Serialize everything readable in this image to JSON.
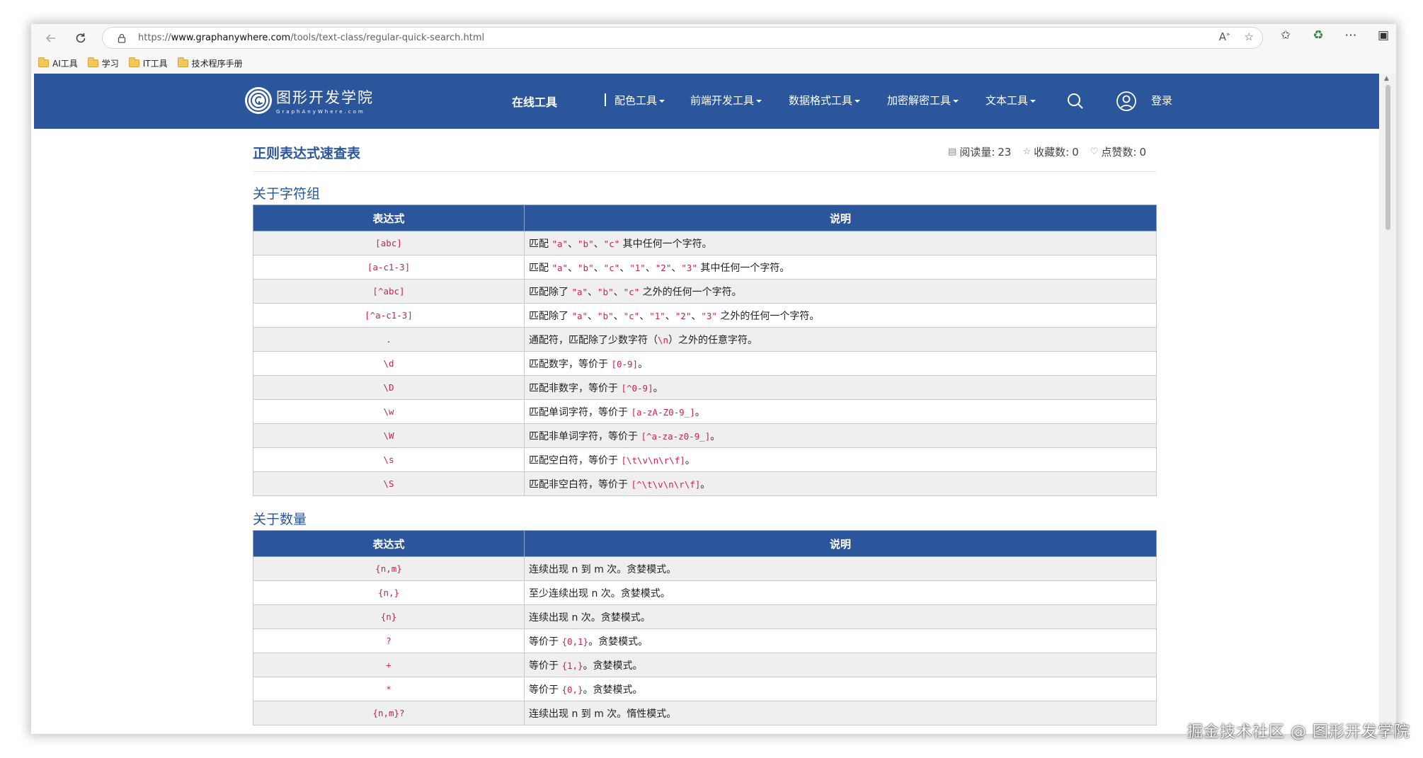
{
  "browser": {
    "url_prefix": "https://",
    "url_domain": "www.graphanywhere.com",
    "url_path": "/tools/text-class/regular-quick-search.html",
    "bookmarks": [
      {
        "label": "AI工具"
      },
      {
        "label": "学习"
      },
      {
        "label": "IT工具"
      },
      {
        "label": "技术程序手册"
      }
    ]
  },
  "site": {
    "logo_cn": "图形开发学院",
    "logo_en": "GraphAnyWhere.com",
    "nav_main": "在线工具",
    "nav": [
      {
        "label": "配色工具"
      },
      {
        "label": "前端开发工具"
      },
      {
        "label": "数据格式工具"
      },
      {
        "label": "加密解密工具"
      },
      {
        "label": "文本工具"
      }
    ],
    "login": "登录",
    "brand_color": "#2c569c"
  },
  "page": {
    "title": "正则表达式速查表",
    "reads_label": "阅读量:",
    "reads": "23",
    "favs_label": "收藏数:",
    "favs": "0",
    "likes_label": "点赞数:",
    "likes": "0"
  },
  "section1": {
    "title": "关于字符组",
    "col_expr": "表达式",
    "col_desc": "说明",
    "rows": [
      {
        "expr": "[abc]",
        "desc": [
          {
            "t": "匹配 "
          },
          {
            "c": "\"a\""
          },
          {
            "t": "、"
          },
          {
            "c": "\"b\""
          },
          {
            "t": "、"
          },
          {
            "c": "\"c\""
          },
          {
            "t": " 其中任何一个字符。"
          }
        ]
      },
      {
        "expr": "[a-c1-3]",
        "desc": [
          {
            "t": "匹配 "
          },
          {
            "c": "\"a\""
          },
          {
            "t": "、"
          },
          {
            "c": "\"b\""
          },
          {
            "t": "、"
          },
          {
            "c": "\"c\""
          },
          {
            "t": "、"
          },
          {
            "c": "\"1\""
          },
          {
            "t": "、"
          },
          {
            "c": "\"2\""
          },
          {
            "t": "、"
          },
          {
            "c": "\"3\""
          },
          {
            "t": " 其中任何一个字符。"
          }
        ]
      },
      {
        "expr": "[^abc]",
        "desc": [
          {
            "t": "匹配除了 "
          },
          {
            "c": "\"a\""
          },
          {
            "t": "、"
          },
          {
            "c": "\"b\""
          },
          {
            "t": "、"
          },
          {
            "c": "\"c\""
          },
          {
            "t": " 之外的任何一个字符。"
          }
        ]
      },
      {
        "expr": "[^a-c1-3]",
        "desc": [
          {
            "t": "匹配除了 "
          },
          {
            "c": "\"a\""
          },
          {
            "t": "、"
          },
          {
            "c": "\"b\""
          },
          {
            "t": "、"
          },
          {
            "c": "\"c\""
          },
          {
            "t": "、"
          },
          {
            "c": "\"1\""
          },
          {
            "t": "、"
          },
          {
            "c": "\"2\""
          },
          {
            "t": "、"
          },
          {
            "c": "\"3\""
          },
          {
            "t": " 之外的任何一个字符。"
          }
        ]
      },
      {
        "expr": ".",
        "desc": [
          {
            "t": "通配符，匹配除了少数字符（"
          },
          {
            "c": "\\n"
          },
          {
            "t": "）之外的任意字符。"
          }
        ]
      },
      {
        "expr": "\\d",
        "desc": [
          {
            "t": "匹配数字，等价于 "
          },
          {
            "c": "[0-9]"
          },
          {
            "t": "。"
          }
        ]
      },
      {
        "expr": "\\D",
        "desc": [
          {
            "t": "匹配非数字，等价于 "
          },
          {
            "c": "[^0-9]"
          },
          {
            "t": "。"
          }
        ]
      },
      {
        "expr": "\\w",
        "desc": [
          {
            "t": "匹配单词字符，等价于 "
          },
          {
            "c": "[a-zA-Z0-9_]"
          },
          {
            "t": "。"
          }
        ]
      },
      {
        "expr": "\\W",
        "desc": [
          {
            "t": "匹配非单词字符，等价于 "
          },
          {
            "c": "[^a-za-z0-9_]"
          },
          {
            "t": "。"
          }
        ]
      },
      {
        "expr": "\\s",
        "desc": [
          {
            "t": "匹配空白符，等价于 "
          },
          {
            "c": "[\\t\\v\\n\\r\\f]"
          },
          {
            "t": "。"
          }
        ]
      },
      {
        "expr": "\\S",
        "desc": [
          {
            "t": "匹配非空白符，等价于 "
          },
          {
            "c": "[^\\t\\v\\n\\r\\f]"
          },
          {
            "t": "。"
          }
        ]
      }
    ]
  },
  "section2": {
    "title": "关于数量",
    "col_expr": "表达式",
    "col_desc": "说明",
    "rows": [
      {
        "expr": "{n,m}",
        "desc": [
          {
            "t": "连续出现 n 到 m 次。贪婪模式。"
          }
        ]
      },
      {
        "expr": "{n,}",
        "desc": [
          {
            "t": "至少连续出现 n 次。贪婪模式。"
          }
        ]
      },
      {
        "expr": "{n}",
        "desc": [
          {
            "t": "连续出现 n 次。贪婪模式。"
          }
        ]
      },
      {
        "expr": "?",
        "desc": [
          {
            "t": "等价于 "
          },
          {
            "c": "{0,1}"
          },
          {
            "t": "。贪婪模式。"
          }
        ]
      },
      {
        "expr": "+",
        "desc": [
          {
            "t": "等价于 "
          },
          {
            "c": "{1,}"
          },
          {
            "t": "。贪婪模式。"
          }
        ]
      },
      {
        "expr": "*",
        "desc": [
          {
            "t": "等价于 "
          },
          {
            "c": "{0,}"
          },
          {
            "t": "。贪婪模式。"
          }
        ]
      },
      {
        "expr": "{n,m}?",
        "desc": [
          {
            "t": "连续出现 n 到 m 次。惰性模式。"
          }
        ]
      }
    ]
  },
  "watermark": "掘金技术社区 @ 图形开发学院"
}
